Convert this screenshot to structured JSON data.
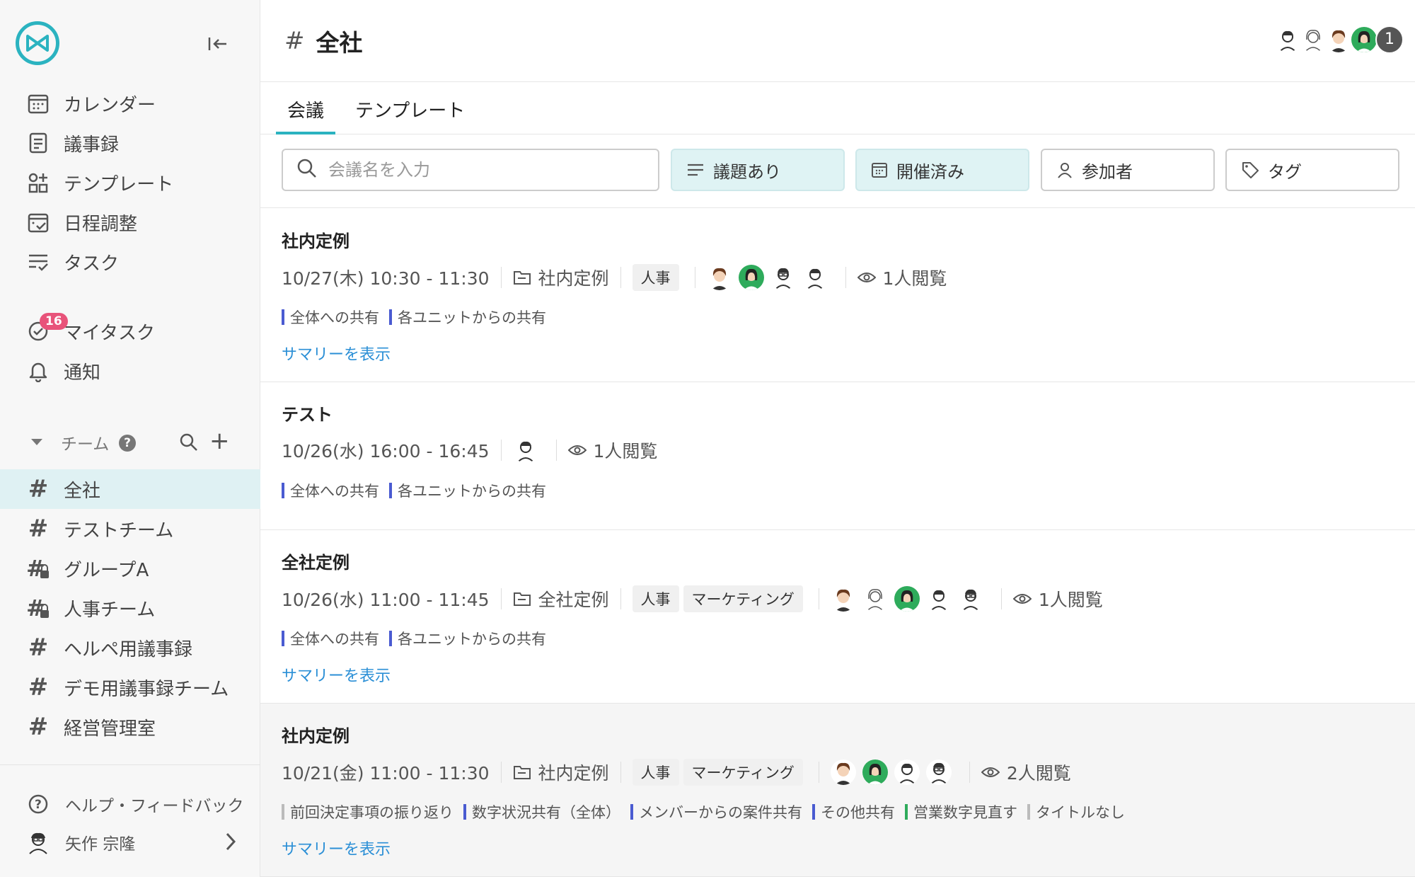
{
  "sidebar": {
    "nav": [
      {
        "icon": "calendar-icon",
        "label": "カレンダー"
      },
      {
        "icon": "minutes-icon",
        "label": "議事録"
      },
      {
        "icon": "template-icon",
        "label": "テンプレート"
      },
      {
        "icon": "schedule-icon",
        "label": "日程調整"
      },
      {
        "icon": "task-icon",
        "label": "タスク"
      }
    ],
    "my_task": {
      "label": "マイタスク",
      "badge": "16"
    },
    "notify": {
      "label": "通知"
    },
    "teams_header": {
      "label": "チーム",
      "help": "?"
    },
    "teams": [
      {
        "label": "全社",
        "locked": false,
        "active": true
      },
      {
        "label": "テストチーム",
        "locked": false
      },
      {
        "label": "グループA",
        "locked": true
      },
      {
        "label": "人事チーム",
        "locked": true
      },
      {
        "label": "ヘルペ用議事録",
        "locked": false
      },
      {
        "label": "デモ用議事録チーム",
        "locked": false
      },
      {
        "label": "経営管理室",
        "locked": false
      }
    ],
    "help_feedback": "ヘルプ・フィードバック",
    "user_name": "矢作 宗隆"
  },
  "header": {
    "title": "全社",
    "member_count": "1"
  },
  "tabs": [
    {
      "label": "会議",
      "active": true
    },
    {
      "label": "テンプレート",
      "active": false
    }
  ],
  "filters": {
    "search_placeholder": "会議名を入力",
    "agenda": "議題あり",
    "held": "開催済み",
    "participants": "参加者",
    "tag": "タグ"
  },
  "meetings": [
    {
      "title": "社内定例",
      "datetime": "10/27(木) 10:30 - 11:30",
      "folder": "社内定例",
      "tags": [
        "人事"
      ],
      "viewed": "1人閲覧",
      "agenda": [
        {
          "label": "全体への共有",
          "color": "#4a5bd1"
        },
        {
          "label": "各ユニットからの共有",
          "color": "#4a5bd1"
        }
      ],
      "summary": "サマリーを表示"
    },
    {
      "title": "テスト",
      "datetime": "10/26(水) 16:00 - 16:45",
      "viewed": "1人閲覧",
      "agenda": [
        {
          "label": "全体への共有",
          "color": "#4a5bd1"
        },
        {
          "label": "各ユニットからの共有",
          "color": "#4a5bd1"
        }
      ]
    },
    {
      "title": "全社定例",
      "datetime": "10/26(水) 11:00 - 11:45",
      "folder": "全社定例",
      "tags": [
        "人事",
        "マーケティング"
      ],
      "viewed": "1人閲覧",
      "agenda": [
        {
          "label": "全体への共有",
          "color": "#4a5bd1"
        },
        {
          "label": "各ユニットからの共有",
          "color": "#4a5bd1"
        }
      ],
      "summary": "サマリーを表示"
    },
    {
      "title": "社内定例",
      "datetime": "10/21(金) 11:00 - 11:30",
      "folder": "社内定例",
      "tags": [
        "人事",
        "マーケティング"
      ],
      "viewed": "2人閲覧",
      "agenda": [
        {
          "label": "前回決定事項の振り返り",
          "color": "#bbbbbb"
        },
        {
          "label": "数字状況共有（全体）",
          "color": "#4a5bd1"
        },
        {
          "label": "メンバーからの案件共有",
          "color": "#4a5bd1"
        },
        {
          "label": "その他共有",
          "color": "#4a5bd1"
        },
        {
          "label": "営業数字見直す",
          "color": "#2eab5b"
        },
        {
          "label": "タイトルなし",
          "color": "#bbbbbb"
        }
      ],
      "summary": "サマリーを表示"
    }
  ],
  "colors": {
    "accent": "#2bb3c0",
    "link": "#2b8fd6",
    "badge": "#e8537a"
  }
}
